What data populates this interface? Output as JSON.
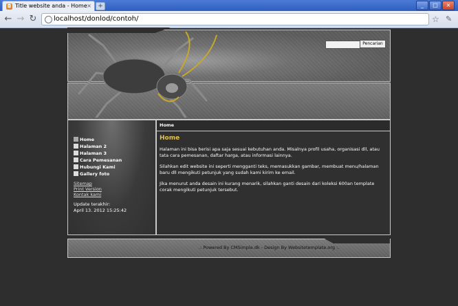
{
  "browser": {
    "tab_title": "Title website anda - Home",
    "tab_close": "×",
    "new_tab": "+",
    "url_host": "localhost/donlod/contoh/",
    "win_minimize": "_",
    "win_maximize": "□",
    "win_close": "×",
    "back": "←",
    "forward": "→",
    "reload": "↻",
    "star": "☆",
    "wrench": "✎"
  },
  "header": {
    "search_button": "Pencarian"
  },
  "sidebar": {
    "menu": [
      "Home",
      "Halaman 2",
      "Halaman 3",
      "Cara Pemesanan",
      "Hubungi Kami",
      "Gallery foto"
    ],
    "links": [
      "Sitemap",
      "Print Version",
      "Kontak kami"
    ],
    "updated_label": "Update terakhir:",
    "updated_value": "April 13. 2012 15:25:42"
  },
  "content": {
    "breadcrumb": "Home",
    "title": "Home",
    "paragraphs": [
      "Halaman ini bisa berisi apa saja sesuai kebutuhan anda. Misalnya profil usaha, organisasi dll, atau tata cara pemesanan, daftar harga, atau informasi lainnya.",
      "Silahkan edit website ini seperti mengganti teks, memasukkan gambar, membuat menu/halaman baru dll mengikuti petunjuk yang sudah kami kirim ke email.",
      "Jika menurut anda desain ini kurang menarik, silahkan ganti desain dari koleksi 600an template corak mengikuti petunjuk tersebut."
    ]
  },
  "footer": {
    "text": ".: Powered By CMSimple.dk - Design By Websitetemplate.org :."
  },
  "colors": {
    "accent_title": "#e3c44a",
    "page_bg": "#2e2e2e",
    "browser_blue": "#2f5fbf"
  }
}
